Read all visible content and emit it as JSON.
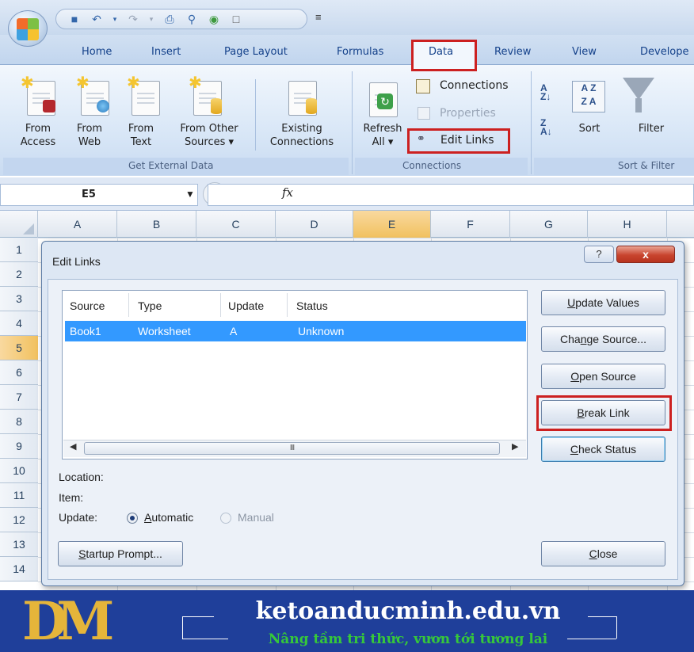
{
  "qat": {
    "icons": [
      "save-icon",
      "undo-icon",
      "redo-icon",
      "print-icon",
      "print-preview-icon",
      "spelling-icon",
      "new-icon"
    ],
    "more": "₹"
  },
  "tabs": [
    "Home",
    "Insert",
    "Page Layout",
    "Formulas",
    "Data",
    "Review",
    "View",
    "Develope"
  ],
  "ribbon": {
    "get_external": {
      "from_access": [
        "From",
        "Access"
      ],
      "from_web": [
        "From",
        "Web"
      ],
      "from_text": [
        "From",
        "Text"
      ],
      "from_other": [
        "From Other",
        "Sources ▾"
      ],
      "existing": [
        "Existing",
        "Connections"
      ],
      "label": "Get External Data"
    },
    "connections": {
      "refresh": [
        "Refresh",
        "All ▾"
      ],
      "connections": "Connections",
      "properties": "Properties",
      "edit_links": "Edit Links",
      "label": "Connections"
    },
    "sort_filter": {
      "sort": "Sort",
      "filter": "Filter",
      "label": "Sort & Filter"
    }
  },
  "formula_bar": {
    "name_box": "E5",
    "fx": "fx"
  },
  "columns": [
    "A",
    "B",
    "C",
    "D",
    "E",
    "F",
    "G",
    "H"
  ],
  "selected_column": "E",
  "rows": [
    "1",
    "2",
    "3",
    "4",
    "5",
    "6",
    "7",
    "8",
    "9",
    "10",
    "11",
    "12",
    "13",
    "14"
  ],
  "selected_row": "5",
  "dialog": {
    "title": "Edit Links",
    "help": "?",
    "close_x": "x",
    "headers": [
      "Source",
      "Type",
      "Update",
      "Status"
    ],
    "selected_link": {
      "source": "Book1",
      "type": "Worksheet",
      "update": "A",
      "status": "Unknown"
    },
    "scroll_thumb_grip": "III",
    "buttons": {
      "update_values": [
        "U",
        "pdate Values"
      ],
      "change_source": [
        "Cha",
        "n",
        "ge Source..."
      ],
      "open_source": [
        "O",
        "pen Source"
      ],
      "break_link": [
        "B",
        "reak Link"
      ],
      "check_status": [
        "C",
        "heck Status"
      ],
      "startup_prompt": [
        "S",
        "tartup Prompt..."
      ],
      "close": [
        "C",
        "lose"
      ]
    },
    "location_label": "Location:",
    "item_label": "Item:",
    "update_label": "Update:",
    "radio_automatic": [
      "A",
      "utomatic"
    ],
    "radio_manual": "Manual",
    "update_mode": "Automatic"
  },
  "banner": {
    "logo_text": "DM",
    "title": "ketoanducminh.edu.vn",
    "subtitle": "Nâng tầm tri thức, vươn tới tương lai"
  },
  "colors": {
    "highlight_red": "#cc2020",
    "selection_blue": "#3399ff",
    "banner_blue": "#1f3f9a",
    "banner_green": "#36c83a",
    "logo_gold": "#e5b53a"
  }
}
